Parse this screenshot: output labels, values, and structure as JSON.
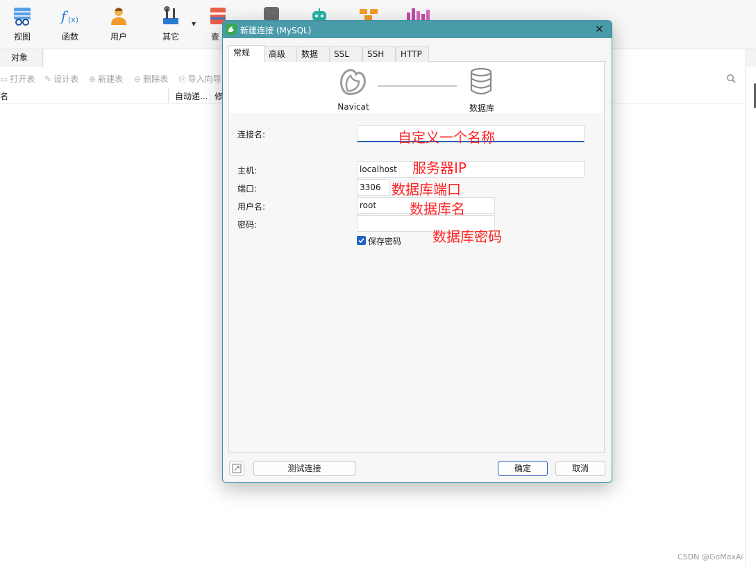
{
  "toolbar": {
    "items": [
      {
        "label": "视图",
        "icon": "view-icon"
      },
      {
        "label": "函数",
        "icon": "function-icon"
      },
      {
        "label": "用户",
        "icon": "user-icon"
      },
      {
        "label": "其它",
        "icon": "tools-icon"
      },
      {
        "label": "查",
        "icon": "query-icon"
      }
    ]
  },
  "object_tab": {
    "label": "对象"
  },
  "actions": {
    "open_table": "打开表",
    "design_table": "设计表",
    "new_table": "新建表",
    "delete_table": "删除表",
    "import_wizard": "导入向导"
  },
  "columns": {
    "name": "名",
    "auto_increment": "自动递...",
    "modified": "修"
  },
  "dialog": {
    "title": "新建连接 (MySQL)",
    "tabs": [
      "常规",
      "高级",
      "数据库",
      "SSL",
      "SSH",
      "HTTP"
    ],
    "active_tab": "常规",
    "banner": {
      "left_label": "Navicat",
      "right_label": "数据库"
    },
    "fields": {
      "connection_name": {
        "label": "连接名:",
        "value": ""
      },
      "host": {
        "label": "主机:",
        "value": "localhost"
      },
      "port": {
        "label": "端口:",
        "value": "3306"
      },
      "username": {
        "label": "用户名:",
        "value": "root"
      },
      "password": {
        "label": "密码:",
        "value": ""
      }
    },
    "save_password": {
      "label": "保存密码",
      "checked": true
    },
    "buttons": {
      "test": "测试连接",
      "ok": "确定",
      "cancel": "取消"
    }
  },
  "annotations": {
    "connection_name": "自定义一个名称",
    "host": "服务器IP",
    "port": "数据库端口",
    "username": "数据库名",
    "password": "数据库密码"
  },
  "watermark": "CSDN @GoMaxAi",
  "colors": {
    "title_bar": "#4a9baa",
    "annotation": "#ff2525",
    "accent": "#2a64b8",
    "checkbox": "#1e64c8"
  }
}
